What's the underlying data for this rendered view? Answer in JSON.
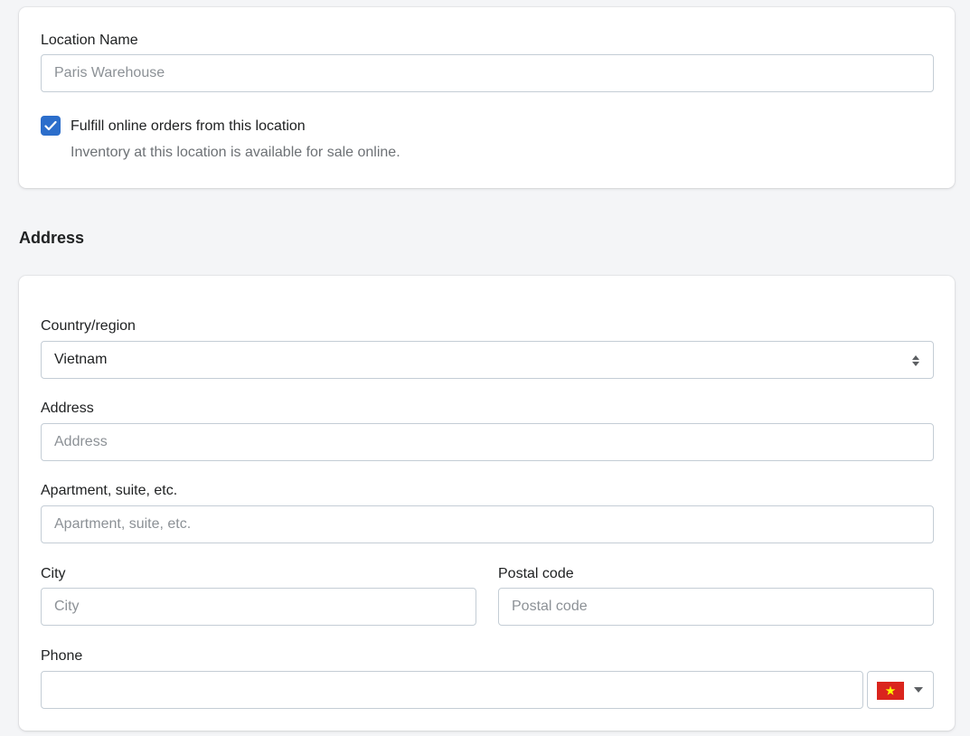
{
  "location": {
    "name_label": "Location Name",
    "name_value": "Paris Warehouse",
    "fulfill_label": "Fulfill online orders from this location",
    "fulfill_checked": true,
    "fulfill_help": "Inventory at this location is available for sale online."
  },
  "address_section": {
    "title": "Address",
    "country_label": "Country/region",
    "country_value": "Vietnam",
    "address_label": "Address",
    "address_placeholder": "Address",
    "apartment_label": "Apartment, suite, etc.",
    "apartment_placeholder": "Apartment, suite, etc.",
    "city_label": "City",
    "city_placeholder": "City",
    "postal_label": "Postal code",
    "postal_placeholder": "Postal code",
    "phone_label": "Phone",
    "phone_value": "",
    "phone_country_flag": "vietnam-flag-icon"
  },
  "colors": {
    "accent": "#2c6ecb",
    "flag_red": "#da251d",
    "flag_star": "#ffff00"
  }
}
